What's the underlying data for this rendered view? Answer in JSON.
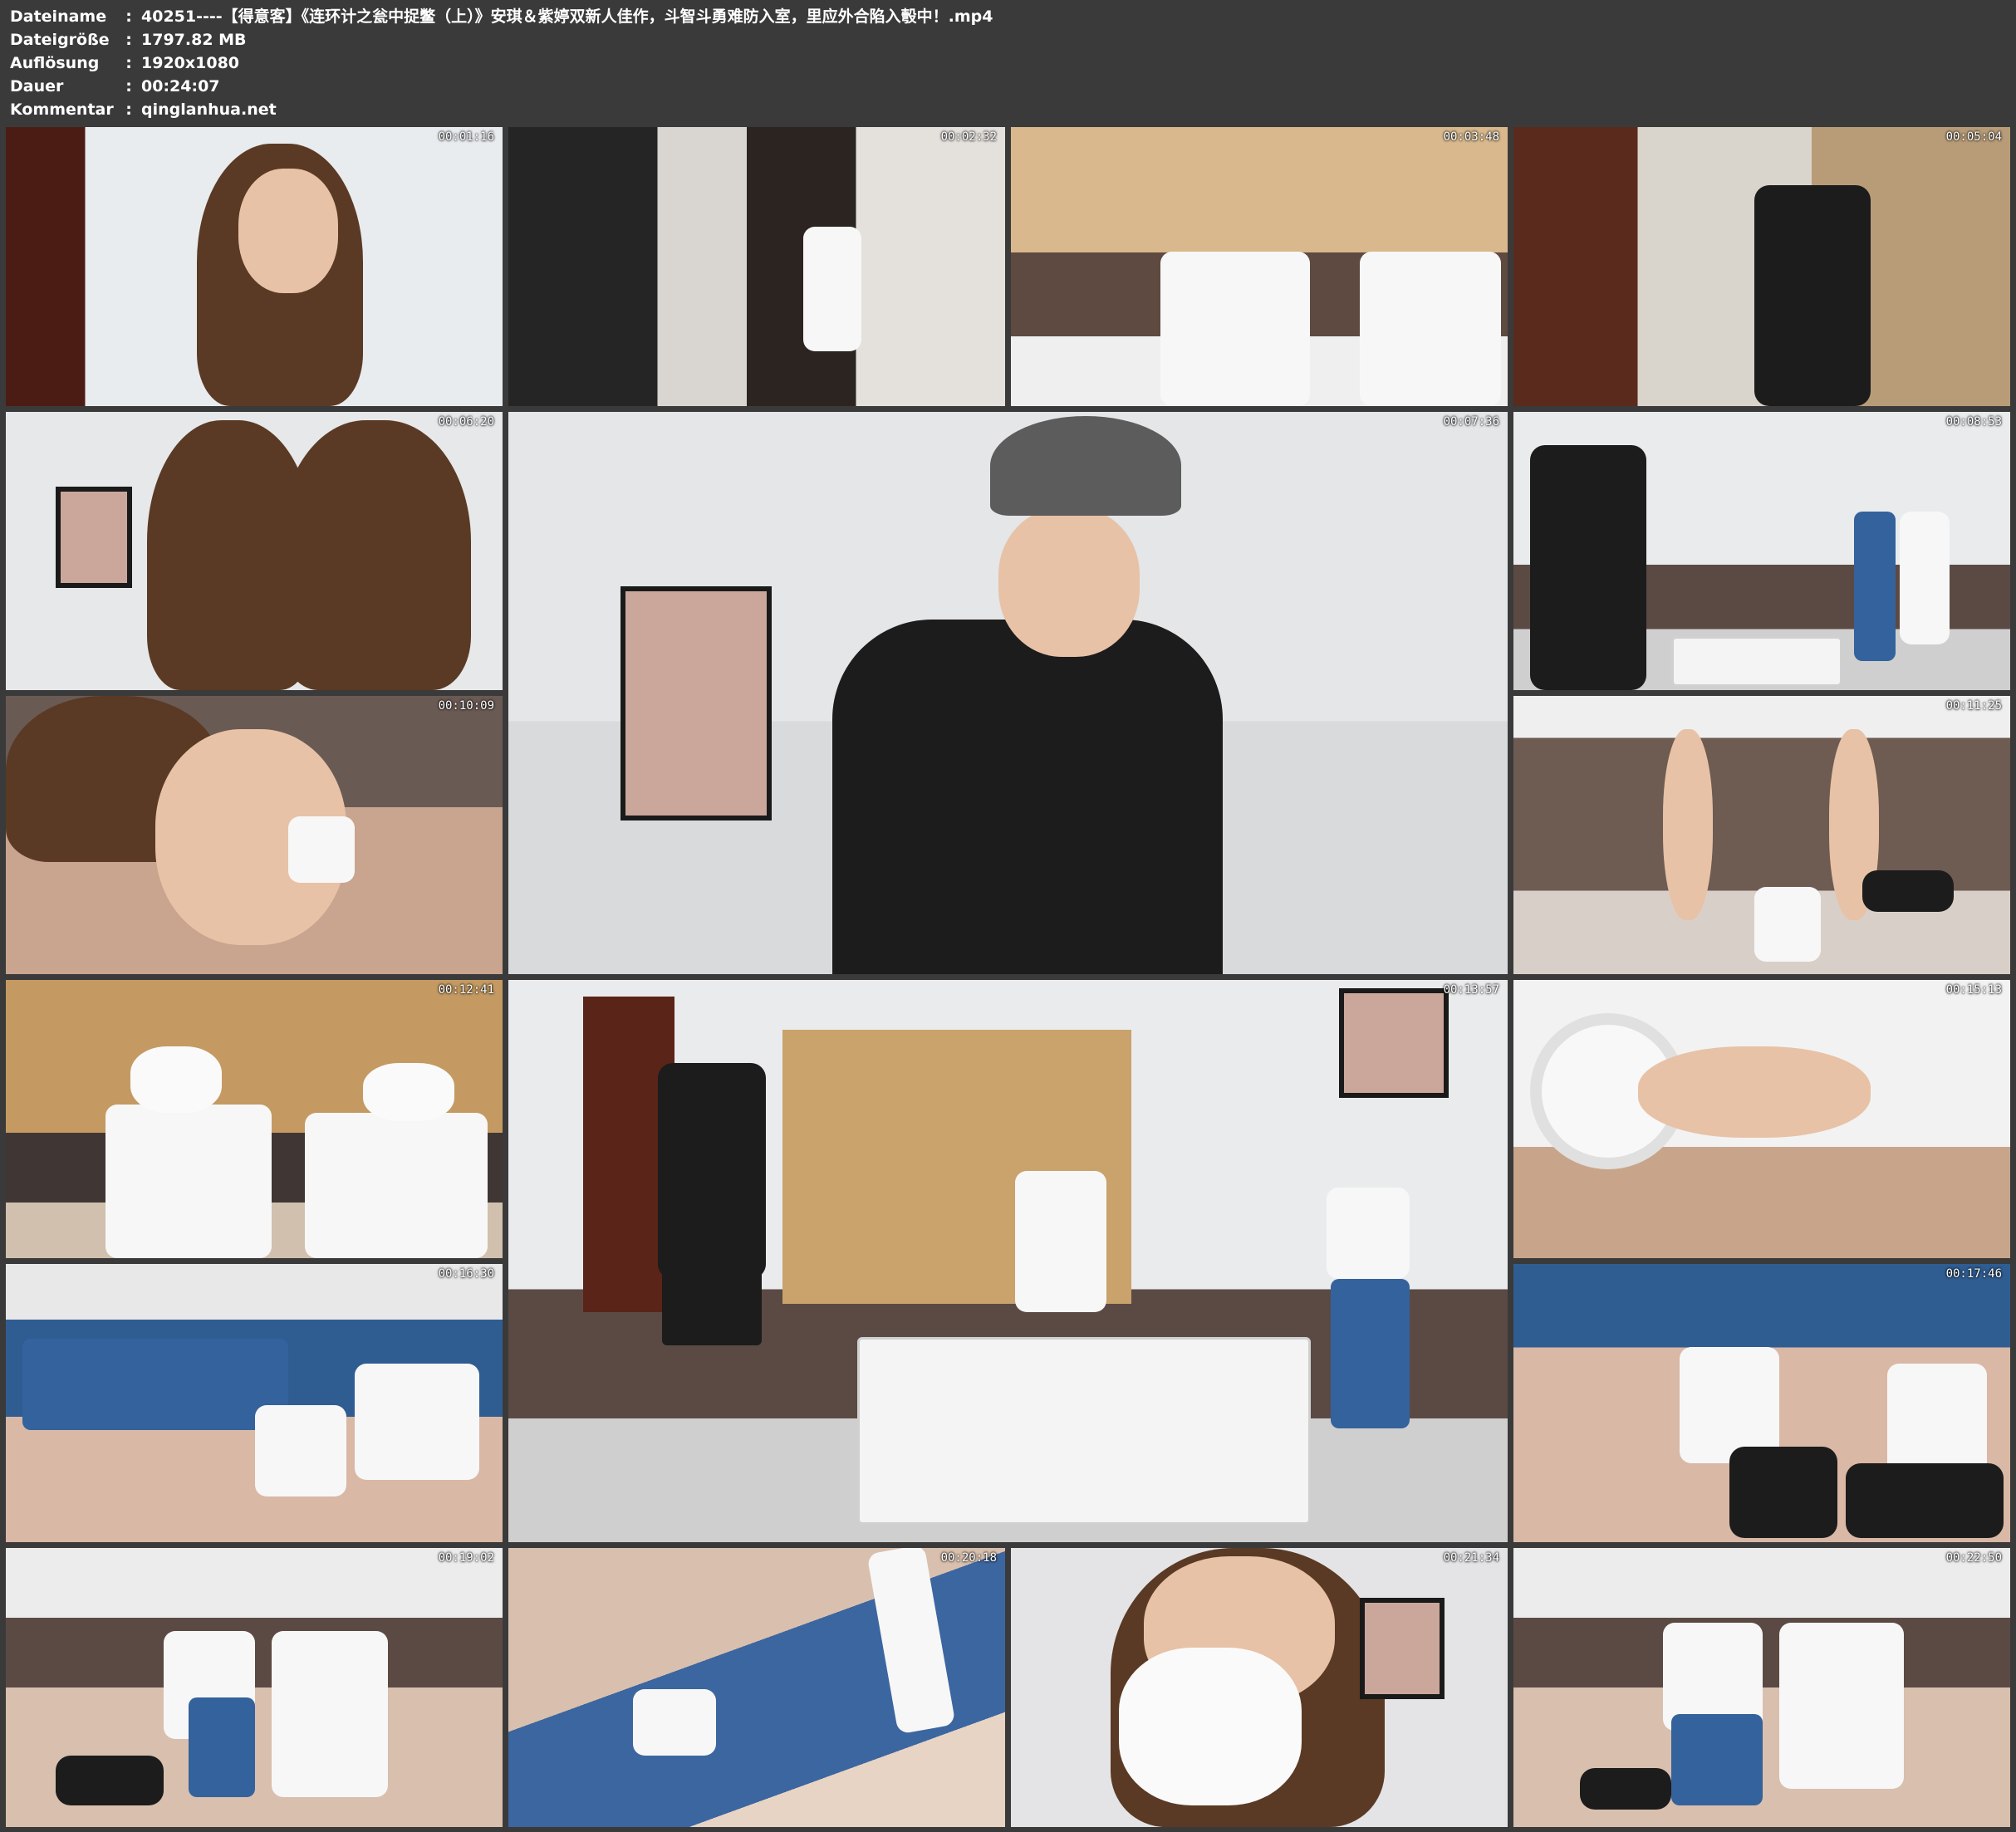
{
  "info": {
    "rows": [
      {
        "key": "Dateiname",
        "sep": ":",
        "value": "40251----【得意客】《连环计之瓮中捉鳖（上）》安琪＆紫婷双新人佳作，斗智斗勇难防入室，里应外合陷入彀中！.mp4"
      },
      {
        "key": "Dateigröße",
        "sep": ":",
        "value": "1797.82 MB"
      },
      {
        "key": "Auflösung",
        "sep": ":",
        "value": "1920x1080"
      },
      {
        "key": "Dauer",
        "sep": ":",
        "value": "00:24:07"
      },
      {
        "key": "Kommentar",
        "sep": ":",
        "value": "qinglanhua.net"
      }
    ]
  },
  "thumbnails": [
    {
      "time": "00:01:16",
      "scene": "room"
    },
    {
      "time": "00:02:32",
      "scene": "door"
    },
    {
      "time": "00:03:48",
      "scene": "sofa"
    },
    {
      "time": "00:05:04",
      "scene": "hall"
    },
    {
      "time": "00:06:20",
      "scene": "wall"
    },
    {
      "time": "00:07:36",
      "scene": "big"
    },
    {
      "time": "00:08:53",
      "scene": "living"
    },
    {
      "time": "00:10:09",
      "scene": "close"
    },
    {
      "time": "00:11:25",
      "scene": "couch"
    },
    {
      "time": "00:12:41",
      "scene": "screen"
    },
    {
      "time": "00:13:57",
      "scene": "living-wide"
    },
    {
      "time": "00:15:13",
      "scene": "tape"
    },
    {
      "time": "00:16:30",
      "scene": "rug"
    },
    {
      "time": "00:17:46",
      "scene": "rug2"
    },
    {
      "time": "00:19:02",
      "scene": "floor"
    },
    {
      "time": "00:20:18",
      "scene": "jeans"
    },
    {
      "time": "00:21:34",
      "scene": "face"
    },
    {
      "time": "00:22:50",
      "scene": "floor"
    }
  ]
}
